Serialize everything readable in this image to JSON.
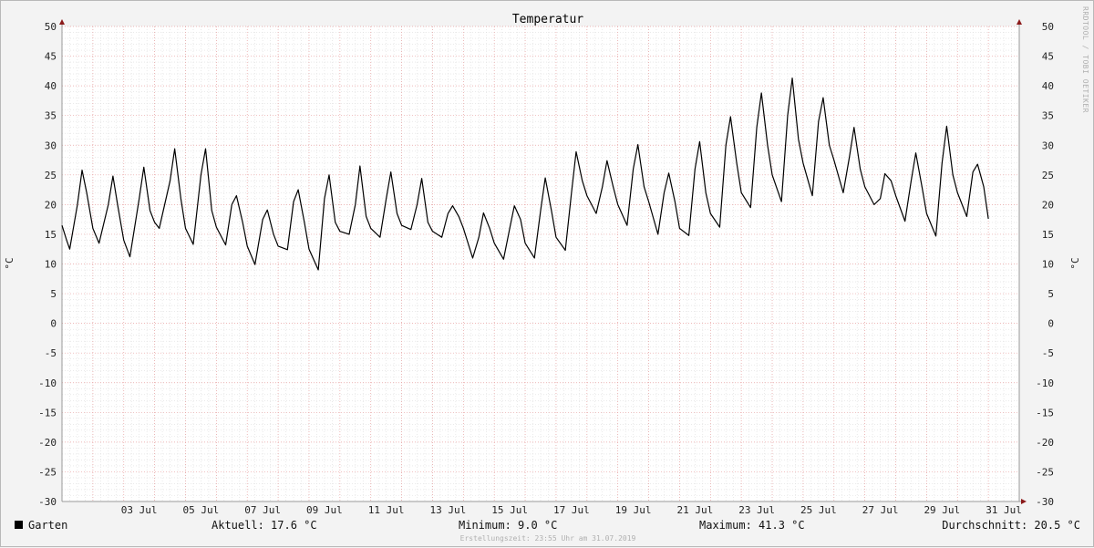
{
  "chart_data": {
    "type": "line",
    "title": "Temperatur",
    "ylabel": "°C",
    "ylim": [
      -30,
      50
    ],
    "yticks": [
      50,
      45,
      40,
      35,
      30,
      25,
      20,
      15,
      10,
      5,
      0,
      -5,
      -10,
      -15,
      -20,
      -25,
      -30
    ],
    "xlim": [
      1.0,
      32.0
    ],
    "xticks": [
      {
        "day": 3,
        "label": "03 Jul"
      },
      {
        "day": 5,
        "label": "05 Jul"
      },
      {
        "day": 7,
        "label": "07 Jul"
      },
      {
        "day": 9,
        "label": "09 Jul"
      },
      {
        "day": 11,
        "label": "11 Jul"
      },
      {
        "day": 13,
        "label": "13 Jul"
      },
      {
        "day": 15,
        "label": "15 Jul"
      },
      {
        "day": 17,
        "label": "17 Jul"
      },
      {
        "day": 19,
        "label": "19 Jul"
      },
      {
        "day": 21,
        "label": "21 Jul"
      },
      {
        "day": 23,
        "label": "23 Jul"
      },
      {
        "day": 25,
        "label": "25 Jul"
      },
      {
        "day": 27,
        "label": "27 Jul"
      },
      {
        "day": 29,
        "label": "29 Jul"
      },
      {
        "day": 31,
        "label": "31 Jul"
      }
    ],
    "grid": true,
    "series": [
      {
        "name": "Garten",
        "color": "#000000",
        "points": [
          [
            1.0,
            16.5
          ],
          [
            1.15,
            14.0
          ],
          [
            1.25,
            12.5
          ],
          [
            1.5,
            20.0
          ],
          [
            1.65,
            25.8
          ],
          [
            1.8,
            22.0
          ],
          [
            2.0,
            16.0
          ],
          [
            2.2,
            13.5
          ],
          [
            2.5,
            20.0
          ],
          [
            2.65,
            24.8
          ],
          [
            2.8,
            20.0
          ],
          [
            3.0,
            14.0
          ],
          [
            3.2,
            11.2
          ],
          [
            3.5,
            21.0
          ],
          [
            3.65,
            26.3
          ],
          [
            3.85,
            19.0
          ],
          [
            4.0,
            17.0
          ],
          [
            4.15,
            16.0
          ],
          [
            4.5,
            24.0
          ],
          [
            4.65,
            29.4
          ],
          [
            4.85,
            21.0
          ],
          [
            5.0,
            16.0
          ],
          [
            5.25,
            13.3
          ],
          [
            5.5,
            25.0
          ],
          [
            5.65,
            29.4
          ],
          [
            5.85,
            19.0
          ],
          [
            6.0,
            16.2
          ],
          [
            6.3,
            13.2
          ],
          [
            6.5,
            20.0
          ],
          [
            6.65,
            21.5
          ],
          [
            6.85,
            17.0
          ],
          [
            7.0,
            13.0
          ],
          [
            7.25,
            9.9
          ],
          [
            7.5,
            17.5
          ],
          [
            7.65,
            19.1
          ],
          [
            7.85,
            15.0
          ],
          [
            8.0,
            13.0
          ],
          [
            8.3,
            12.4
          ],
          [
            8.5,
            20.5
          ],
          [
            8.65,
            22.5
          ],
          [
            8.85,
            17.0
          ],
          [
            9.0,
            12.5
          ],
          [
            9.3,
            9.0
          ],
          [
            9.5,
            21.0
          ],
          [
            9.65,
            25.0
          ],
          [
            9.85,
            17.0
          ],
          [
            10.0,
            15.5
          ],
          [
            10.3,
            15.0
          ],
          [
            10.5,
            20.0
          ],
          [
            10.65,
            26.5
          ],
          [
            10.85,
            18.0
          ],
          [
            11.0,
            16.0
          ],
          [
            11.3,
            14.5
          ],
          [
            11.5,
            21.0
          ],
          [
            11.65,
            25.5
          ],
          [
            11.85,
            18.5
          ],
          [
            12.0,
            16.5
          ],
          [
            12.3,
            15.8
          ],
          [
            12.5,
            20.0
          ],
          [
            12.65,
            24.4
          ],
          [
            12.85,
            17.0
          ],
          [
            13.0,
            15.5
          ],
          [
            13.3,
            14.5
          ],
          [
            13.5,
            18.5
          ],
          [
            13.65,
            19.8
          ],
          [
            13.85,
            18.0
          ],
          [
            14.0,
            16.0
          ],
          [
            14.3,
            11.0
          ],
          [
            14.5,
            14.5
          ],
          [
            14.65,
            18.6
          ],
          [
            14.85,
            16.0
          ],
          [
            15.0,
            13.5
          ],
          [
            15.3,
            10.8
          ],
          [
            15.5,
            16.0
          ],
          [
            15.65,
            19.8
          ],
          [
            15.85,
            17.5
          ],
          [
            16.0,
            13.5
          ],
          [
            16.3,
            11.0
          ],
          [
            16.5,
            19.0
          ],
          [
            16.65,
            24.5
          ],
          [
            16.85,
            19.0
          ],
          [
            17.0,
            14.5
          ],
          [
            17.3,
            12.3
          ],
          [
            17.5,
            22.0
          ],
          [
            17.65,
            28.9
          ],
          [
            17.85,
            24.0
          ],
          [
            18.0,
            21.5
          ],
          [
            18.3,
            18.5
          ],
          [
            18.5,
            23.0
          ],
          [
            18.65,
            27.4
          ],
          [
            18.85,
            23.0
          ],
          [
            19.0,
            20.0
          ],
          [
            19.3,
            16.5
          ],
          [
            19.5,
            26.0
          ],
          [
            19.65,
            30.1
          ],
          [
            19.85,
            23.0
          ],
          [
            20.0,
            20.5
          ],
          [
            20.3,
            15.0
          ],
          [
            20.5,
            22.0
          ],
          [
            20.65,
            25.3
          ],
          [
            20.85,
            20.5
          ],
          [
            21.0,
            16.0
          ],
          [
            21.3,
            14.8
          ],
          [
            21.5,
            26.0
          ],
          [
            21.65,
            30.6
          ],
          [
            21.85,
            22.0
          ],
          [
            22.0,
            18.5
          ],
          [
            22.3,
            16.2
          ],
          [
            22.5,
            30.0
          ],
          [
            22.65,
            34.8
          ],
          [
            22.85,
            27.0
          ],
          [
            23.0,
            22.0
          ],
          [
            23.3,
            19.5
          ],
          [
            23.5,
            33.0
          ],
          [
            23.65,
            38.8
          ],
          [
            23.85,
            30.0
          ],
          [
            24.0,
            25.0
          ],
          [
            24.3,
            20.5
          ],
          [
            24.5,
            35.0
          ],
          [
            24.65,
            41.3
          ],
          [
            24.85,
            31.0
          ],
          [
            25.0,
            27.0
          ],
          [
            25.3,
            21.5
          ],
          [
            25.5,
            34.0
          ],
          [
            25.65,
            38.0
          ],
          [
            25.85,
            30.0
          ],
          [
            26.0,
            27.5
          ],
          [
            26.3,
            22.0
          ],
          [
            26.5,
            28.0
          ],
          [
            26.65,
            33.0
          ],
          [
            26.85,
            26.0
          ],
          [
            27.0,
            23.0
          ],
          [
            27.3,
            20.0
          ],
          [
            27.5,
            21.0
          ],
          [
            27.65,
            25.2
          ],
          [
            27.85,
            24.0
          ],
          [
            28.0,
            21.5
          ],
          [
            28.3,
            17.2
          ],
          [
            28.5,
            24.0
          ],
          [
            28.65,
            28.7
          ],
          [
            28.85,
            23.0
          ],
          [
            29.0,
            18.5
          ],
          [
            29.3,
            14.7
          ],
          [
            29.5,
            27.0
          ],
          [
            29.65,
            33.2
          ],
          [
            29.85,
            25.0
          ],
          [
            30.0,
            22.0
          ],
          [
            30.3,
            18.0
          ],
          [
            30.5,
            25.5
          ],
          [
            30.65,
            26.8
          ],
          [
            30.85,
            23.0
          ],
          [
            31.0,
            17.6
          ]
        ]
      }
    ]
  },
  "watermark": "RRDTOOL / TOBI OETIKER",
  "legend": {
    "series_name": "Garten",
    "current": "Aktuell: 17.6 °C",
    "minimum": "Minimum: 9.0 °C",
    "maximum": "Maximum: 41.3 °C",
    "average": "Durchschnitt: 20.5 °C"
  },
  "footer": "Erstellungszeit: 23:55 Uhr am 31.07.2019"
}
